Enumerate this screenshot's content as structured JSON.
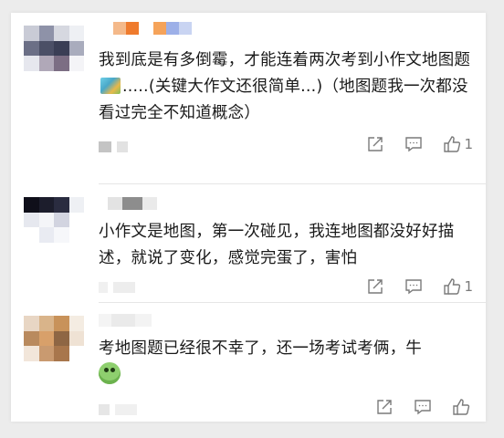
{
  "comments": [
    {
      "text_before": "我到底是有多倒霉，才能连着两次考到小作文地图题",
      "emoji": "map-emoji",
      "text_after": ".....(关键大作文还很简单...)（地图题我一次都没看过完全不知道概念）",
      "likes": "1"
    },
    {
      "text": "小作文是地图，第一次碰见，我连地图都没好好描述，就说了变化，感觉完蛋了，害怕",
      "likes": "1"
    },
    {
      "text": "考地图题已经很不幸了，还一场考试考俩，牛",
      "emoji": "frog-emoji",
      "likes": ""
    }
  ],
  "icons": {
    "share": "share-icon",
    "reply": "reply-icon",
    "like": "thumbs-up-icon"
  },
  "colors": {
    "text": "#1a1a1a",
    "icon": "#7a7a7a",
    "divider": "#e6e6e6"
  }
}
